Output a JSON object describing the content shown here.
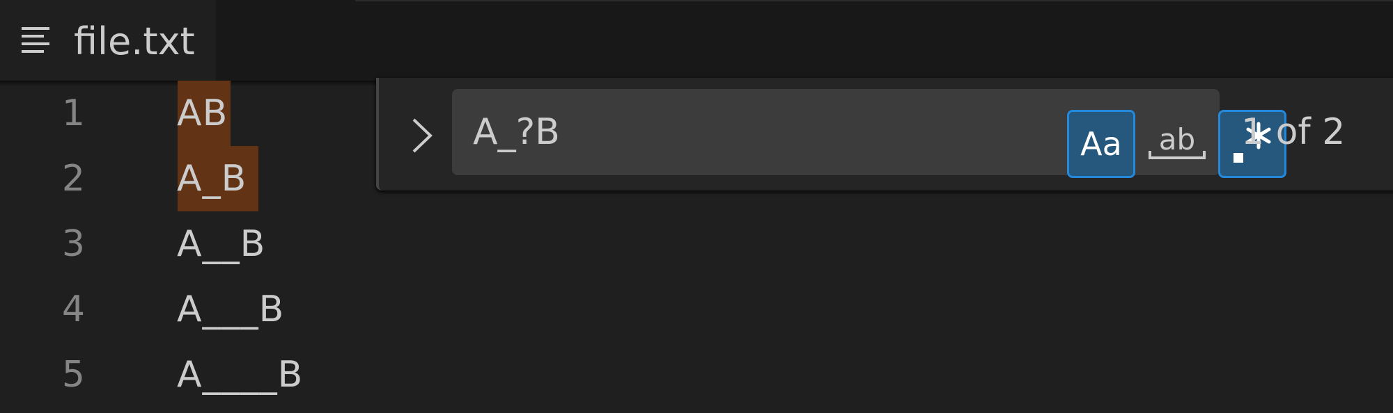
{
  "tab": {
    "icon": "text-lines-icon",
    "file_name": "file.txt"
  },
  "editor": {
    "lines": [
      {
        "number": "1",
        "text": "AB"
      },
      {
        "number": "2",
        "text": "A_B"
      },
      {
        "number": "3",
        "text": "A__B"
      },
      {
        "number": "4",
        "text": "A___B"
      },
      {
        "number": "5",
        "text": "A____B"
      }
    ]
  },
  "find_widget": {
    "toggle_icon": "chevron-right-icon",
    "search_value": "A_?B",
    "match_case_label": "Aa",
    "whole_word_label": "ab",
    "regex_icon": "regex-icon",
    "match_case_active": true,
    "whole_word_active": false,
    "regex_active": true,
    "match_count": "1 of 2"
  },
  "colors": {
    "match_highlight": "#623315",
    "toggle_active_bg": "#25587c",
    "toggle_active_border": "#2489db"
  }
}
